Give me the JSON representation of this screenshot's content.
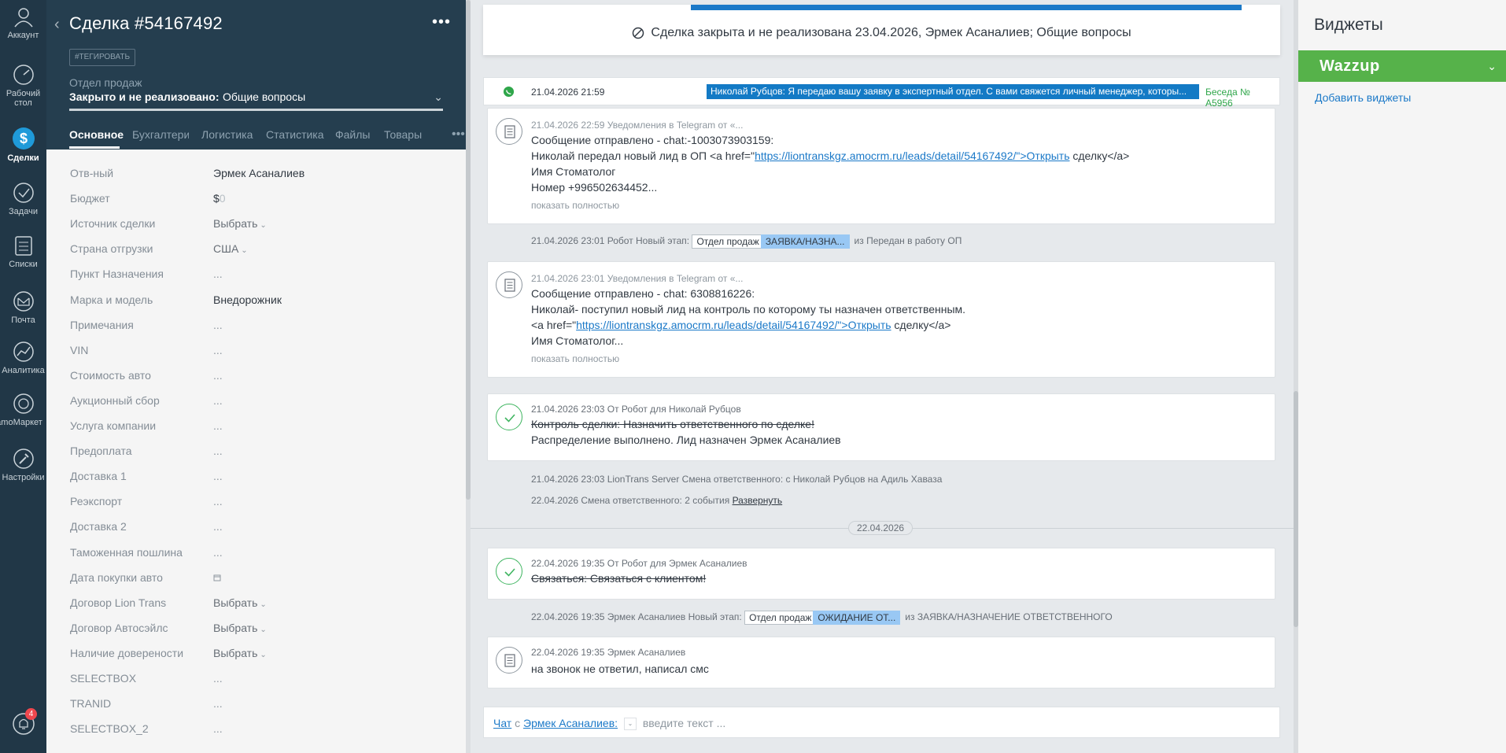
{
  "nav": {
    "items": [
      {
        "label": "Аккаунт",
        "icon": "account-icon"
      },
      {
        "label": "Рабочий стол",
        "icon": "dashboard-icon"
      },
      {
        "label": "Сделки",
        "icon": "leads-icon"
      },
      {
        "label": "Задачи",
        "icon": "tasks-icon"
      },
      {
        "label": "Списки",
        "icon": "lists-icon"
      },
      {
        "label": "Почта",
        "icon": "mail-icon"
      },
      {
        "label": "Аналитика",
        "icon": "analytics-icon"
      },
      {
        "label": "amoМаркет",
        "icon": "market-icon"
      },
      {
        "label": "Настройки",
        "icon": "settings-icon"
      }
    ],
    "notifications_count": "4"
  },
  "card": {
    "title": "Сделка #54167492",
    "tag_button": "#ТЕГИРОВАТЬ",
    "pipeline": "Отдел продаж",
    "stage_status": "Закрыто и не реализовано:",
    "stage_reason": "Общие вопросы",
    "tabs": [
      "Основное",
      "Бухгалтерия",
      "Логистика",
      "Статистика",
      "Файлы",
      "Товары"
    ],
    "fields": [
      {
        "label": "Отв-ный",
        "value": "Эрмек Асаналиев"
      },
      {
        "label": "Бюджет",
        "value": "$",
        "extra": "0"
      },
      {
        "label": "Источник сделки",
        "value": "Выбрать"
      },
      {
        "label": "Страна отгрузки",
        "value": "США"
      },
      {
        "label": "Пункт Назначения",
        "value": "..."
      },
      {
        "label": "Марка и модель",
        "value": "Внедорожник"
      },
      {
        "label": "Примечания",
        "value": "..."
      },
      {
        "label": "VIN",
        "value": "..."
      },
      {
        "label": "Стоимость авто",
        "value": "..."
      },
      {
        "label": "Аукционный сбор",
        "value": "..."
      },
      {
        "label": "Услуга компании",
        "value": "..."
      },
      {
        "label": "Предоплата",
        "value": "..."
      },
      {
        "label": "Доставка 1",
        "value": "..."
      },
      {
        "label": "Реэкспорт",
        "value": "..."
      },
      {
        "label": "Доставка 2",
        "value": "..."
      },
      {
        "label": "Таможенная пошлина",
        "value": "..."
      },
      {
        "label": "Дата покупки авто",
        "value": ""
      },
      {
        "label": "Договор Lion Trans",
        "value": "Выбрать"
      },
      {
        "label": "Договор Автосэйлс",
        "value": "Выбрать"
      },
      {
        "label": "Наличие доверености",
        "value": "Выбрать"
      },
      {
        "label": "SELECTBOX",
        "value": "..."
      },
      {
        "label": "TRANID",
        "value": "..."
      },
      {
        "label": "SELECTBOX_2",
        "value": "..."
      }
    ]
  },
  "feed": {
    "closed_banner": "Сделка закрыта и не реализована 23.04.2026, Эрмек Асаналиев; Общие вопросы",
    "pinned": {
      "time": "21.04.2026 21:59",
      "message": "Николай Рубцов: Я передаю вашу заявку в экспертный отдел. С вами свяжется личный менеджер, которы...",
      "conversation": "Беседа № A5956"
    },
    "note1": {
      "meta": "21.04.2026 22:59 Уведомления в Telegram от «...",
      "line1": "Сообщение отправлено - chat:-1003073903159:",
      "line2_pre": "Николай передал новый лид в ОП <a href=\"",
      "line2_link": "https://liontranskgz.amocrm.ru/leads/detail/54167492/\">Открыть",
      "line2_post": " сделку</a>",
      "line3": "Имя Стоматолог",
      "line4": "Номер +996502634452...",
      "more": "показать полностью"
    },
    "sys1": {
      "text": "21.04.2026 23:01 Робот Новый этап:",
      "chip": "Отдел продаж",
      "chip_val": "ЗАЯВКА/НАЗНА...",
      "tail": "из Передан в работу ОП"
    },
    "note2": {
      "meta": "21.04.2026 23:01 Уведомления в Telegram от «...",
      "line1": "Сообщение отправлено - chat: 6308816226:",
      "line2": "Николай- поступил новый лид на контроль по которому ты назначен ответственным.",
      "line3_pre": "<a href=\"",
      "line3_link": "https://liontranskgz.amocrm.ru/leads/detail/54167492/\">Открыть",
      "line3_post": " сделку</a>",
      "line4": "Имя Стоматолог...",
      "more": "показать полностью"
    },
    "task1": {
      "meta": "21.04.2026 23:03  От Робот для Николай Рубцов",
      "line1": "Контроль сделки: Назначить ответственного по сделке!",
      "line2": "Распределение выполнено. Лид назначен Эрмек Асаналиев"
    },
    "sys2": "21.04.2026 23:03 LionTrans Server Смена ответственного: с Николай Рубцов на Адиль Хаваза",
    "sys3": {
      "text": "22.04.2026 Смена ответственного: 2 события",
      "link": "Развернуть"
    },
    "date_sep": "22.04.2026",
    "task2": {
      "meta": "22.04.2026 19:35  От Робот для Эрмек Асаналиев",
      "line1": "Связаться: Связаться с клиентом!"
    },
    "sys4": {
      "text": "22.04.2026 19:35 Эрмек Асаналиев Новый этап:",
      "chip": "Отдел продаж",
      "chip_val": "ОЖИДАНИЕ ОТ...",
      "tail": "из ЗАЯВКА/НАЗНАЧЕНИЕ ОТВЕТСТВЕННОГО"
    },
    "note3": {
      "meta": "22.04.2026 19:35 Эрмек Асаналиев",
      "line1": "на звонок не ответил, написал смс"
    },
    "chat": {
      "type": "Чат",
      "with": "с",
      "contact": "Эрмек Асаналиев:",
      "placeholder": "введите текст ..."
    }
  },
  "widgets": {
    "title": "Виджеты",
    "wazzup": "Wazzup",
    "add": "Добавить виджеты"
  },
  "colors": {
    "nav_bg": "#213747",
    "card_head_bg": "#253e4f",
    "accent_blue": "#1b79c8",
    "wazzup_green": "#56b24a",
    "stage_chip": "#99c8f4"
  }
}
